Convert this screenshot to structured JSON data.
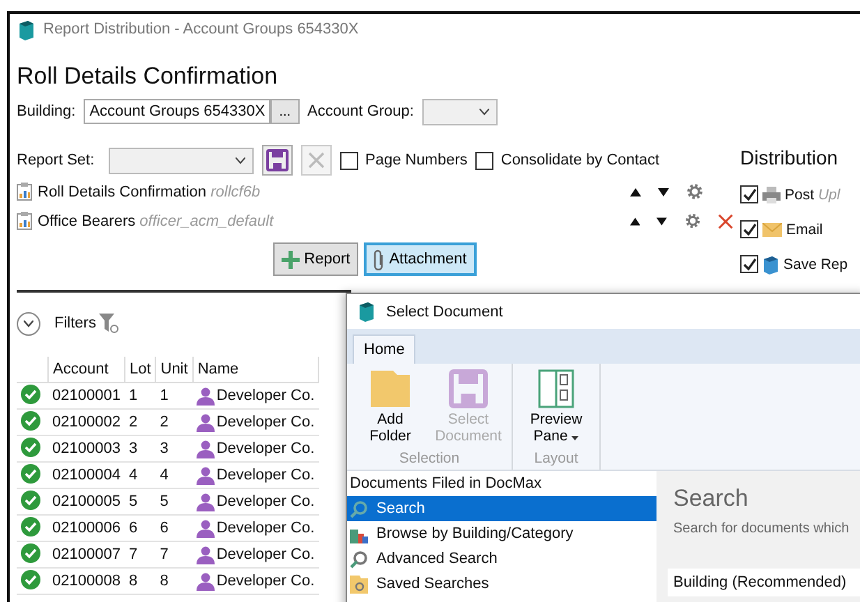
{
  "window": {
    "title": "Report Distribution - Account Groups 654330X"
  },
  "heading": "Roll Details Confirmation",
  "building": {
    "label": "Building:",
    "value": "Account Groups 654330X",
    "browse": "..."
  },
  "account_group": {
    "label": "Account Group:"
  },
  "report_set": {
    "label": "Report Set:"
  },
  "options": [
    {
      "label": "Page Numbers",
      "checked": false
    },
    {
      "label": "Consolidate by Contact",
      "checked": false
    }
  ],
  "reports": [
    {
      "name": "Roll Details Confirmation",
      "code": "rollcf6b",
      "removable": false
    },
    {
      "name": "Office Bearers",
      "code": "officer_acm_default",
      "removable": true
    }
  ],
  "buttons": [
    {
      "label": "Report",
      "kind": "add",
      "selected": false
    },
    {
      "label": "Attachment",
      "kind": "attach",
      "selected": true
    }
  ],
  "distribution": {
    "title": "Distribution",
    "methods": [
      {
        "label": "Post",
        "note": "Upl",
        "checked": true,
        "kind": "post"
      },
      {
        "label": "Email",
        "checked": true,
        "kind": "email"
      },
      {
        "label": "Save Rep",
        "checked": true,
        "kind": "save"
      }
    ]
  },
  "filters": {
    "label": "Filters"
  },
  "table": {
    "columns": [
      "Account",
      "Lot",
      "Unit",
      "Name"
    ],
    "rows": [
      {
        "account": "02100001",
        "lot": "1",
        "unit": "1",
        "name": "Developer Co."
      },
      {
        "account": "02100002",
        "lot": "2",
        "unit": "2",
        "name": "Developer Co."
      },
      {
        "account": "02100003",
        "lot": "3",
        "unit": "3",
        "name": "Developer Co."
      },
      {
        "account": "02100004",
        "lot": "4",
        "unit": "4",
        "name": "Developer Co."
      },
      {
        "account": "02100005",
        "lot": "5",
        "unit": "5",
        "name": "Developer Co."
      },
      {
        "account": "02100006",
        "lot": "6",
        "unit": "6",
        "name": "Developer Co."
      },
      {
        "account": "02100007",
        "lot": "7",
        "unit": "7",
        "name": "Developer Co."
      },
      {
        "account": "02100008",
        "lot": "8",
        "unit": "8",
        "name": "Developer Co."
      }
    ]
  },
  "dialog": {
    "title": "Select Document",
    "tabs": [
      {
        "label": "Home",
        "selected": true
      }
    ],
    "ribbon_groups": [
      {
        "label": "Selection",
        "items": [
          {
            "label": "Add Folder",
            "kind": "folder",
            "disabled": false
          },
          {
            "label": "Select Document",
            "kind": "save",
            "disabled": true
          }
        ]
      },
      {
        "label": "Layout",
        "items": [
          {
            "label": "Preview Pane",
            "kind": "preview",
            "disabled": false
          }
        ]
      }
    ],
    "nav": {
      "title": "Documents Filed in DocMax",
      "items": [
        {
          "label": "Search",
          "kind": "search",
          "selected": true
        },
        {
          "label": "Browse by Building/Category",
          "kind": "browse",
          "selected": false
        },
        {
          "label": "Advanced Search",
          "kind": "advanced",
          "selected": false
        },
        {
          "label": "Saved Searches",
          "kind": "saved",
          "selected": false
        }
      ]
    },
    "search": {
      "title": "Search",
      "description": "Search for documents which",
      "field_label": "Building (Recommended)"
    }
  }
}
